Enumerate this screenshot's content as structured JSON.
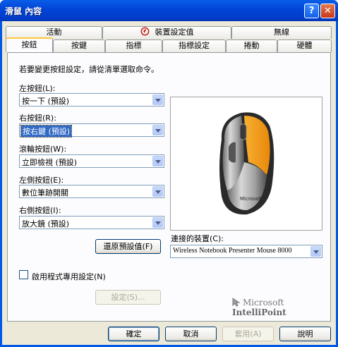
{
  "window": {
    "title": "滑鼠 內容",
    "help_label": "?",
    "close_label": "✕"
  },
  "tabs_row1": [
    "活動",
    "裝置設定值",
    "無線"
  ],
  "tabs_row2": [
    "按鈕",
    "按鍵",
    "指標",
    "指標設定",
    "捲動",
    "硬體"
  ],
  "active_tab": "按鈕",
  "panel": {
    "instruction": "若要變更按鈕設定，請從清單選取命令。",
    "fields": [
      {
        "label": "左按鈕(L):",
        "value": "按一下 (預設)"
      },
      {
        "label": "右按鈕(R):",
        "value": "按右鍵 (預設)"
      },
      {
        "label": "滾輪按鈕(W):",
        "value": "立即檢視 (預設)"
      },
      {
        "label": "左側按鈕(E):",
        "value": "數位筆跡開關"
      },
      {
        "label": "右側按鈕(I):",
        "value": "放大鏡 (預設)"
      }
    ],
    "restore_button": "還原預設值(F)",
    "connected_label": "連接的裝置(C):",
    "connected_value": "Wireless Notebook Presenter Mouse 8000",
    "app_specific_label": "啟用程式專用設定(N)",
    "settings_button": "設定(S)...",
    "brand_ms": "Microsoft",
    "brand_ip": "IntelliPoint"
  },
  "footer": {
    "ok": "確定",
    "cancel": "取消",
    "apply": "套用(A)",
    "help": "說明"
  },
  "colors": {
    "accent_orange": "#f5a01e",
    "titlebar": "#0054e3"
  }
}
